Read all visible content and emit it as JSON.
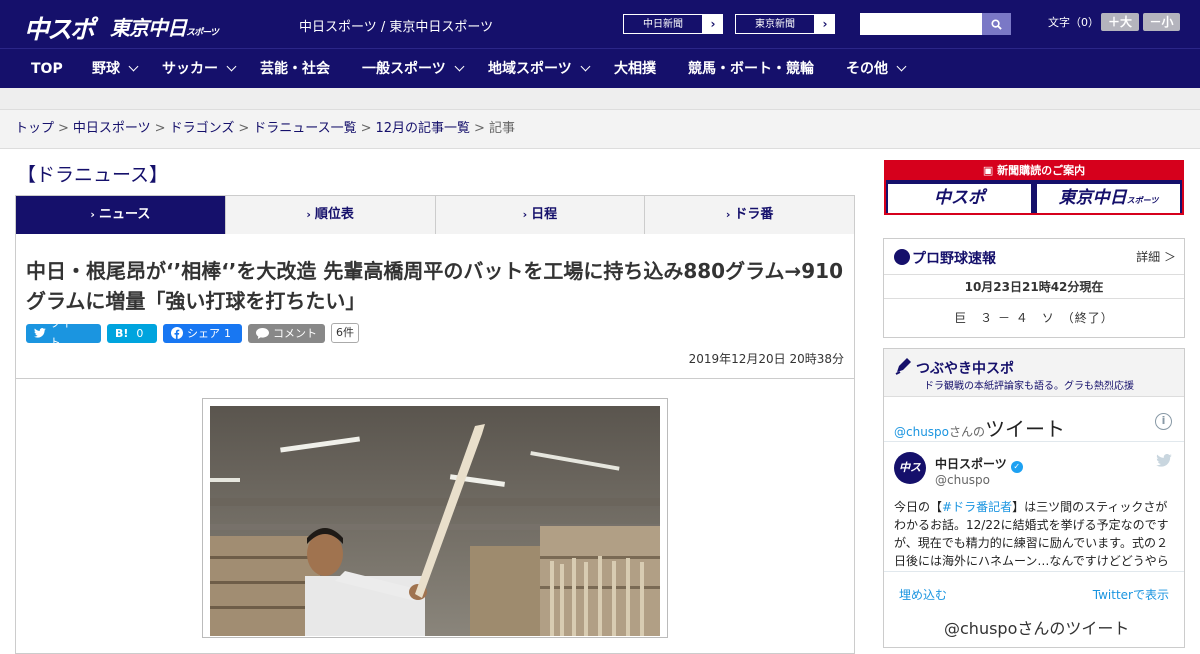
{
  "header": {
    "logo_main": "中スポ",
    "logo_tokyo": "東京中日",
    "logo_tokyo_small": "スポーツ",
    "site_title": "中日スポーツ / 東京中日スポーツ",
    "paper_links": [
      "中日新聞",
      "東京新聞"
    ],
    "paper_arrow": "›",
    "search_placeholder": "",
    "font_size_label": "文字（0）",
    "font_larger": "＋大",
    "font_smaller": "－小"
  },
  "nav": {
    "items": [
      {
        "label": "TOP",
        "has_menu": false
      },
      {
        "label": "野球",
        "has_menu": true
      },
      {
        "label": "サッカー",
        "has_menu": true
      },
      {
        "label": "芸能・社会",
        "has_menu": false
      },
      {
        "label": "一般スポーツ",
        "has_menu": true
      },
      {
        "label": "地域スポーツ",
        "has_menu": true
      },
      {
        "label": "大相撲",
        "has_menu": false
      },
      {
        "label": "競馬・ボート・競輪",
        "has_menu": false
      },
      {
        "label": "その他",
        "has_menu": true
      }
    ]
  },
  "breadcrumb": {
    "items": [
      "トップ",
      "中日スポーツ",
      "ドラゴンズ",
      "ドラニュース一覧",
      "12月の記事一覧"
    ],
    "current": "記事",
    "separator": ">"
  },
  "section": {
    "title": "【ドラニュース】"
  },
  "tabs": {
    "items": [
      "ニュース",
      "順位表",
      "日程",
      "ドラ番"
    ],
    "active": 0,
    "caret": "›"
  },
  "article": {
    "headline": "中日・根尾昂が‘’相棒‘’を大改造 先輩高橋周平のバットを工場に持ち込み880グラム→910グラムに増量「強い打球を打ちたい」",
    "share": {
      "tweet": "ツイート",
      "hatena_label": "B!",
      "hatena_count": "0",
      "facebook": "シェア",
      "facebook_count": "1",
      "comment": "コメント",
      "comment_count": "6件"
    },
    "date": "2019年12月20日 20時38分"
  },
  "sidebar": {
    "subscribe": {
      "header": "新聞購読のご案内",
      "logo_left": "中スポ",
      "logo_right": "東京中日",
      "logo_right_small": "スポーツ"
    },
    "scores": {
      "title": "プロ野球速報",
      "detail": "詳細 ＞",
      "time": "10月23日21時42分現在",
      "game": "巨　３ － ４　ソ　（終了）"
    },
    "tsubuyaki": {
      "title": "つぶやき中スポ",
      "subtitle": "ドラ観戦の本紙評論家も語る。グラも熱烈応援",
      "handle": "@chuspo",
      "handle_suffix": "さんの",
      "handle_big": "ツイート",
      "info": "i",
      "tweet": {
        "name": "中日スポーツ",
        "user": "@chuspo",
        "avatar_text": "中スポ",
        "text_pre": "今日の【",
        "text_tag": "#ドラ番記者",
        "text_post": "】は三ツ間のスティックさがわかるお話。12/22に結婚式を挙げる予定なのですが、現在でも精力的に練習に励んでいます。式の２日後には海外にハネムーン…なんですけどどうやら"
      },
      "embed": "埋め込む",
      "view_on_twitter": "Twitterで表示",
      "more": "@chuspoさんのツイート"
    }
  },
  "colors": {
    "brand": "#15106b",
    "accent_red": "#d6001c",
    "twitter": "#1b95e0",
    "facebook": "#1877f2",
    "hatena": "#00a4de"
  }
}
